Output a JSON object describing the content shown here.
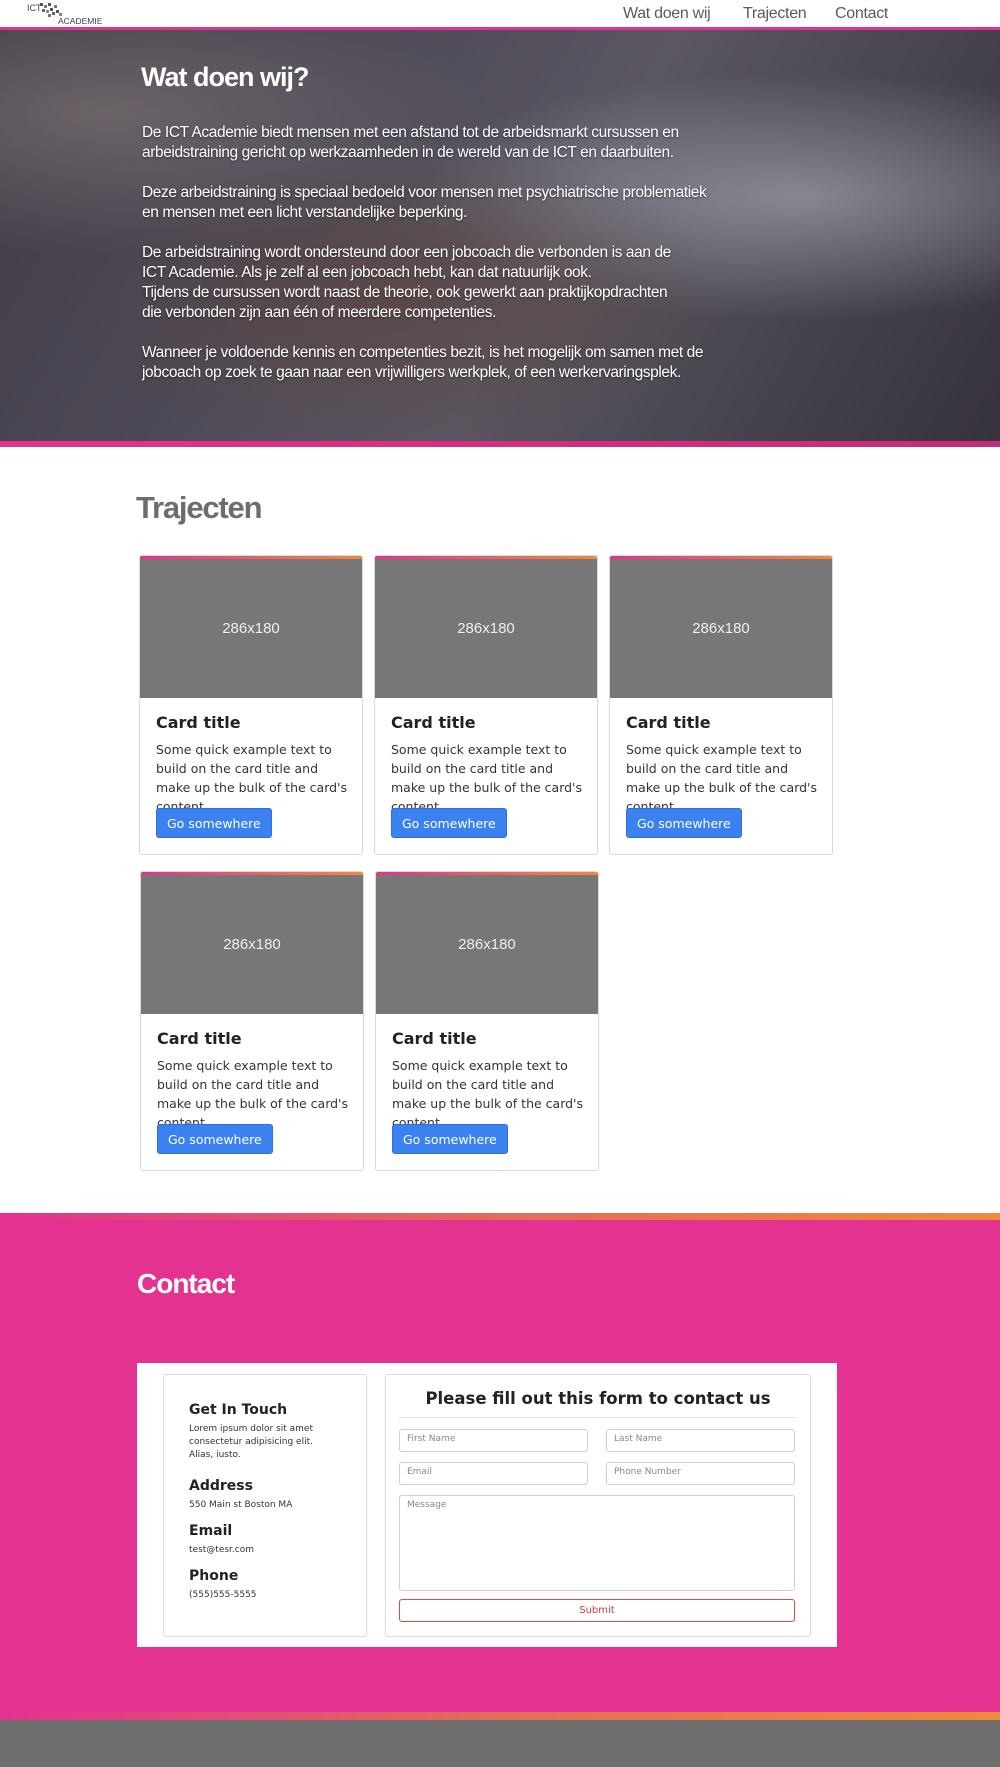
{
  "nav": {
    "logo_top": "ICT",
    "logo_bottom": "ACADEMIE",
    "links": [
      "Wat doen wij",
      "Trajecten",
      "Contact"
    ]
  },
  "hero": {
    "title": "Wat doen wij?",
    "paragraphs": [
      "De ICT Academie biedt mensen met een afstand tot de arbeidsmarkt cursussen en\narbeidstraining gericht op werkzaamheden in de wereld van de ICT en daarbuiten.",
      "Deze arbeidstraining is speciaal bedoeld voor mensen met psychiatrische problematiek\nen mensen met een licht verstandelijke beperking.",
      "De arbeidstraining wordt ondersteund door een jobcoach die verbonden is aan de\nICT Academie. Als je zelf al een jobcoach hebt, kan dat natuurlijk ook.\nTijdens de cursussen wordt naast de theorie, ook gewerkt aan praktijkopdrachten\ndie verbonden zijn aan één of meerdere competenties.",
      "Wanneer je voldoende kennis en competenties bezit, is het mogelijk om samen met de\njobcoach op zoek te gaan naar een vrijwilligers werkplek, of een werkervaringsplek."
    ]
  },
  "trajecten": {
    "title": "Trajecten",
    "cards": [
      {
        "image_label": "286x180",
        "title": "Card title",
        "text": "Some quick example text to build on the card title and make up the bulk of the card's content.",
        "button": "Go somewhere"
      },
      {
        "image_label": "286x180",
        "title": "Card title",
        "text": "Some quick example text to build on the card title and make up the bulk of the card's content.",
        "button": "Go somewhere"
      },
      {
        "image_label": "286x180",
        "title": "Card title",
        "text": "Some quick example text to build on the card title and make up the bulk of the card's content.",
        "button": "Go somewhere"
      },
      {
        "image_label": "286x180",
        "title": "Card title",
        "text": "Some quick example text to build on the card title and make up the bulk of the card's content.",
        "button": "Go somewhere"
      },
      {
        "image_label": "286x180",
        "title": "Card title",
        "text": "Some quick example text to build on the card title and make up the bulk of the card's content.",
        "button": "Go somewhere"
      }
    ]
  },
  "contact": {
    "title": "Contact",
    "info": {
      "heading": "Get In Touch",
      "intro": "Lorem ipsum dolor sit amet consectetur adipisicing elit. Alias, iusto.",
      "address_label": "Address",
      "address": "550 Main st Boston MA",
      "email_label": "Email",
      "email": "test@tesr.com",
      "phone_label": "Phone",
      "phone": "(555)555-5555"
    },
    "form": {
      "title": "Please fill out this form to contact us",
      "first_name_placeholder": "First Name",
      "last_name_placeholder": "Last Name",
      "email_placeholder": "Email",
      "phone_placeholder": "Phone Number",
      "message_placeholder": "Message",
      "submit": "Submit"
    }
  },
  "colors": {
    "accent_pink": "#e3328f",
    "accent_orange": "#f08a3c",
    "button_blue": "#3b82f0",
    "footer_gray": "#6e6e6e"
  }
}
